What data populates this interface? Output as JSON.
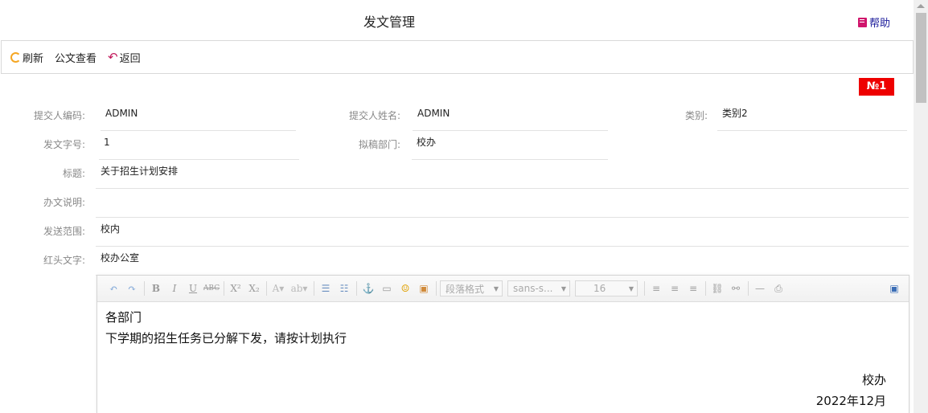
{
  "header": {
    "title": "发文管理",
    "help_label": "帮助"
  },
  "toolbar": {
    "refresh_label": "刷新",
    "view_label": "公文查看",
    "back_label": "返回"
  },
  "badge": {
    "text": "№1"
  },
  "form": {
    "submitter_code_label": "提交人编码:",
    "submitter_code_value": "ADMIN",
    "submitter_name_label": "提交人姓名:",
    "submitter_name_value": "ADMIN",
    "category_label": "类别:",
    "category_value": "类别2",
    "doc_number_label": "发文字号:",
    "doc_number_value": "1",
    "draft_dept_label": "拟稿部门:",
    "draft_dept_value": "校办",
    "subject_label": "标题:",
    "subject_value": "关于招生计划安排",
    "instructions_label": "办文说明:",
    "instructions_value": "",
    "scope_label": "发送范围:",
    "scope_value": "校内",
    "red_header_label": "红头文字:",
    "red_header_value": "校办公室"
  },
  "editor": {
    "paragraph_format": "段落格式",
    "font_family": "sans-s...",
    "font_size": "16",
    "content": {
      "line1": "各部门",
      "line2": "下学期的招生任务已分解下发，请按计划执行",
      "sign": "校办",
      "date": "2022年12月"
    }
  }
}
